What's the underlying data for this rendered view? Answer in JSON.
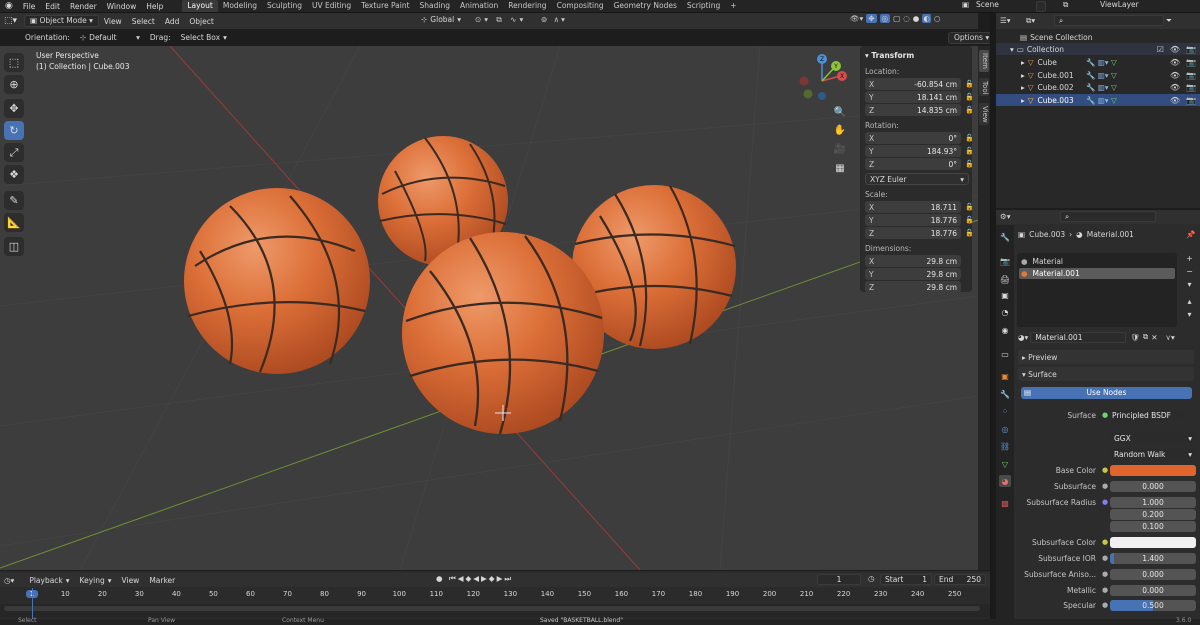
{
  "topbar": {
    "menus": [
      "File",
      "Edit",
      "Render",
      "Window",
      "Help"
    ],
    "workspaces": [
      "Layout",
      "Modeling",
      "Sculpting",
      "UV Editing",
      "Texture Paint",
      "Shading",
      "Animation",
      "Rendering",
      "Compositing",
      "Geometry Nodes",
      "Scripting"
    ],
    "active_workspace": "Layout",
    "add_tab": "+",
    "scene": "Scene",
    "view_layer": "ViewLayer"
  },
  "viewport": {
    "mode": "Object Mode",
    "menus": [
      "View",
      "Select",
      "Add",
      "Object"
    ],
    "transform_orientation": "Global",
    "orientation_label": "Orientation:",
    "orientation_value": "Default",
    "drag_label": "Drag:",
    "drag_value": "Select Box",
    "options": "Options",
    "overlay_title": "User Perspective",
    "overlay_subtitle": "(1) Collection | Cube.003",
    "gizmo": {
      "x": "X",
      "y": "Y",
      "z": "Z"
    }
  },
  "transform_panel": {
    "title": "Transform",
    "location_label": "Location:",
    "location": [
      {
        "axis": "X",
        "value": "-60.854 cm"
      },
      {
        "axis": "Y",
        "value": "18.141 cm"
      },
      {
        "axis": "Z",
        "value": "14.835 cm"
      }
    ],
    "rotation_label": "Rotation:",
    "rotation": [
      {
        "axis": "X",
        "value": "0°"
      },
      {
        "axis": "Y",
        "value": "184.93°"
      },
      {
        "axis": "Z",
        "value": "0°"
      }
    ],
    "rotation_mode": "XYZ Euler",
    "scale_label": "Scale:",
    "scale": [
      {
        "axis": "X",
        "value": "18.711"
      },
      {
        "axis": "Y",
        "value": "18.776"
      },
      {
        "axis": "Z",
        "value": "18.776"
      }
    ],
    "dimensions_label": "Dimensions:",
    "dimensions": [
      {
        "axis": "X",
        "value": "29.8 cm"
      },
      {
        "axis": "Y",
        "value": "29.8 cm"
      },
      {
        "axis": "Z",
        "value": "29.8 cm"
      }
    ]
  },
  "side_tabs": [
    "Item",
    "Tool",
    "View"
  ],
  "outliner": {
    "root": "Scene Collection",
    "collection": "Collection",
    "objects": [
      "Cube",
      "Cube.001",
      "Cube.002",
      "Cube.003"
    ]
  },
  "properties": {
    "breadcrumb_object": "Cube.003",
    "breadcrumb_material": "Material.001",
    "slots": [
      "Material",
      "Material.001"
    ],
    "material_name": "Material.001",
    "preview": "Preview",
    "surface_header": "Surface",
    "use_nodes": "Use Nodes",
    "surface_label": "Surface",
    "surface_value": "Principled BSDF",
    "distribution": "GGX",
    "subsurface_method": "Random Walk",
    "fields": [
      {
        "label": "Base Color",
        "value": ""
      },
      {
        "label": "Subsurface",
        "value": "0.000"
      },
      {
        "label": "Subsurface Radius",
        "value": "1.000"
      },
      {
        "label": "",
        "value": "0.200"
      },
      {
        "label": "",
        "value": "0.100"
      },
      {
        "label": "Subsurface Color",
        "value": ""
      },
      {
        "label": "Subsurface IOR",
        "value": "1.400"
      },
      {
        "label": "Subsurface Aniso...",
        "value": "0.000"
      },
      {
        "label": "Metallic",
        "value": "0.000"
      },
      {
        "label": "Specular",
        "value": "0.500"
      }
    ],
    "specular_fraction": 0.5,
    "ior_fraction": 0.05,
    "base_color": "#e0652c",
    "subsurface_color": "#f0f0f0"
  },
  "timeline": {
    "menus": [
      "Playback",
      "Keying",
      "View",
      "Marker"
    ],
    "current_frame": "1",
    "start_label": "Start",
    "start": "1",
    "end_label": "End",
    "end": "250",
    "ticks": [
      "1",
      "10",
      "20",
      "30",
      "40",
      "50",
      "60",
      "70",
      "80",
      "90",
      "100",
      "110",
      "120",
      "130",
      "140",
      "150",
      "160",
      "170",
      "180",
      "190",
      "200",
      "210",
      "220",
      "230",
      "240",
      "250"
    ]
  },
  "status": {
    "select": "Select",
    "pan": "Pan View",
    "context": "Context Menu",
    "message": "Saved \"BASKETBALL.blend\"",
    "version": "3.6.0"
  },
  "colors": {
    "accent": "#4772b3",
    "ball": "#d76a35",
    "x_axis": "#b3413e",
    "y_axis": "#7ea23a"
  }
}
